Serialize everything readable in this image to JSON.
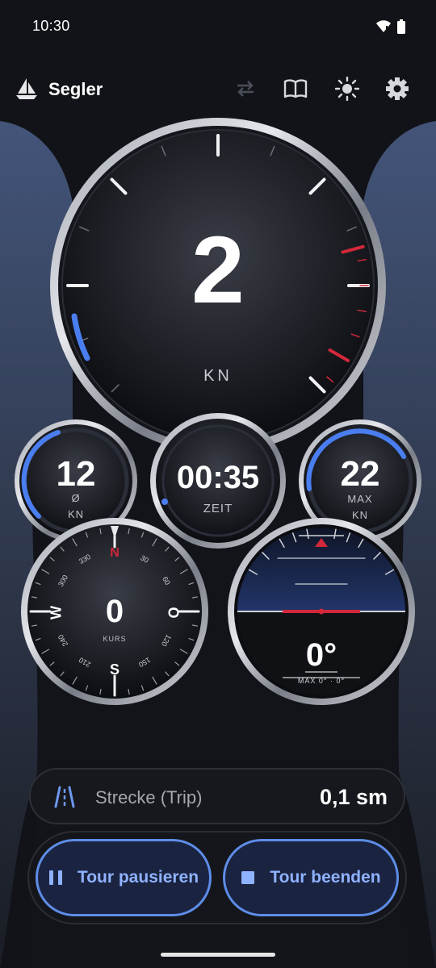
{
  "status": {
    "time": "10:30"
  },
  "app": {
    "title": "Segler"
  },
  "toolbar": {
    "icons": [
      "swap-icon",
      "book-icon",
      "brightness-icon",
      "gear-icon"
    ]
  },
  "speed": {
    "value": "2",
    "unit": "KN"
  },
  "avg": {
    "value": "12",
    "symbol": "Ø",
    "unit": "KN"
  },
  "timer": {
    "value": "00:35",
    "label": "ZEIT"
  },
  "max": {
    "value": "22",
    "label": "MAX",
    "unit": "KN"
  },
  "compass": {
    "heading": "0",
    "label": "KURS",
    "cardinals": {
      "n": "N",
      "e": "O",
      "s": "S",
      "w": "W"
    },
    "degree_labels": [
      "30",
      "60",
      "120",
      "150",
      "210",
      "240",
      "300",
      "330"
    ]
  },
  "heel": {
    "value": "0°",
    "max_label": "MAX 0° · 0°"
  },
  "trip": {
    "label": "Strecke (Trip)",
    "value": "0,1 sm"
  },
  "actions": {
    "pause": "Tour pausieren",
    "stop": "Tour beenden"
  },
  "colors": {
    "accent": "#5e8de8",
    "red": "#d2283a",
    "background": "#111318"
  }
}
